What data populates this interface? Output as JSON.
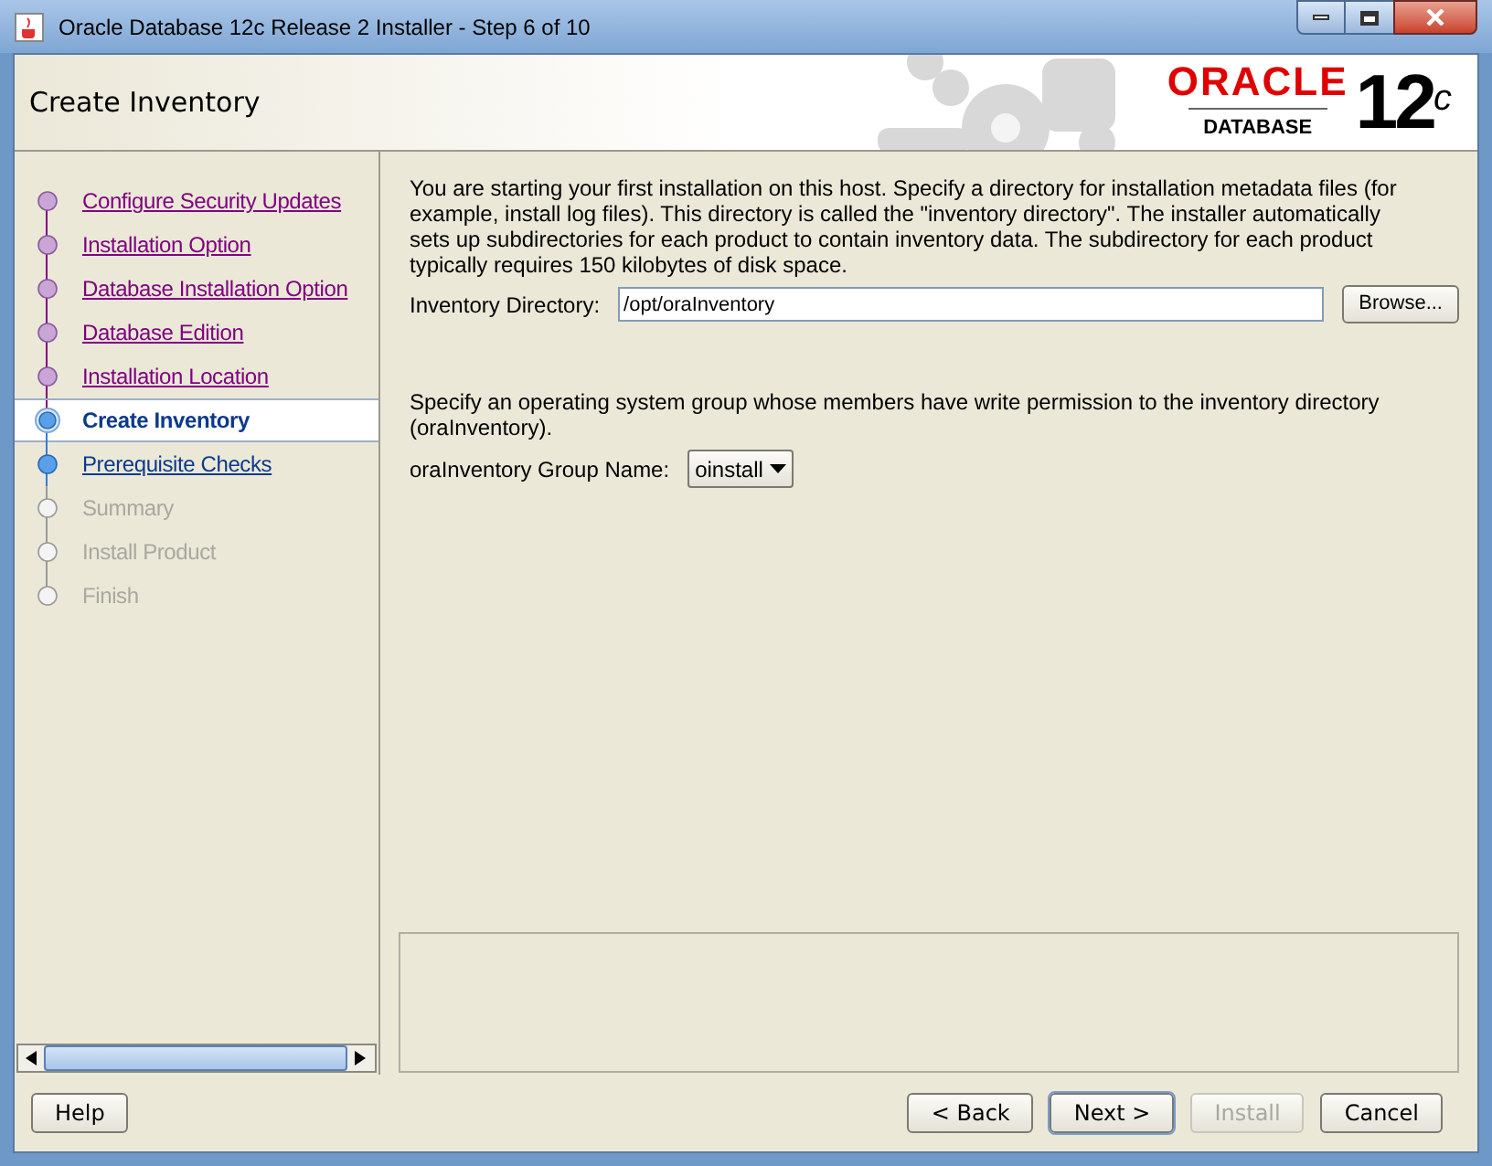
{
  "window": {
    "title": "Oracle Database 12c Release 2 Installer - Step 6 of 10"
  },
  "header": {
    "title": "Create Inventory",
    "logo": {
      "brand": "ORACLE",
      "product": "DATABASE",
      "version": "12",
      "suffix": "c"
    }
  },
  "steps": [
    {
      "label": "Configure Security Updates",
      "visited": true,
      "selected": false,
      "disabled": false
    },
    {
      "label": "Installation Option",
      "visited": true,
      "selected": false,
      "disabled": false
    },
    {
      "label": "Database Installation Option",
      "visited": true,
      "selected": false,
      "disabled": false
    },
    {
      "label": "Database Edition",
      "visited": true,
      "selected": false,
      "disabled": false
    },
    {
      "label": "Installation Location",
      "visited": true,
      "selected": false,
      "disabled": false
    },
    {
      "label": "Create Inventory",
      "visited": false,
      "selected": true,
      "disabled": false
    },
    {
      "label": "Prerequisite Checks",
      "visited": false,
      "selected": false,
      "disabled": false
    },
    {
      "label": "Summary",
      "visited": false,
      "selected": false,
      "disabled": true
    },
    {
      "label": "Install Product",
      "visited": false,
      "selected": false,
      "disabled": true
    },
    {
      "label": "Finish",
      "visited": false,
      "selected": false,
      "disabled": true
    }
  ],
  "content": {
    "intro": "You are starting your first installation on this host. Specify a directory for installation metadata files (for example, install log files). This directory is called the \"inventory directory\". The installer automatically sets up subdirectories for each product to contain inventory data. The subdirectory for each product typically requires 150 kilobytes of disk space.",
    "directory": {
      "label": "Inventory Directory:",
      "value": "/opt/oraInventory",
      "button": "Browse..."
    },
    "group_intro": "Specify an operating system group whose members have write permission to the inventory directory (oraInventory).",
    "group": {
      "label": "oraInventory Group Name:",
      "value": "oinstall"
    }
  },
  "buttons": [
    {
      "label": "Help",
      "disabled": false
    },
    {
      "label": "< Back",
      "disabled": false
    },
    {
      "label": "Next >",
      "disabled": false
    },
    {
      "label": "Install",
      "disabled": true
    },
    {
      "label": "Cancel",
      "disabled": false
    }
  ]
}
